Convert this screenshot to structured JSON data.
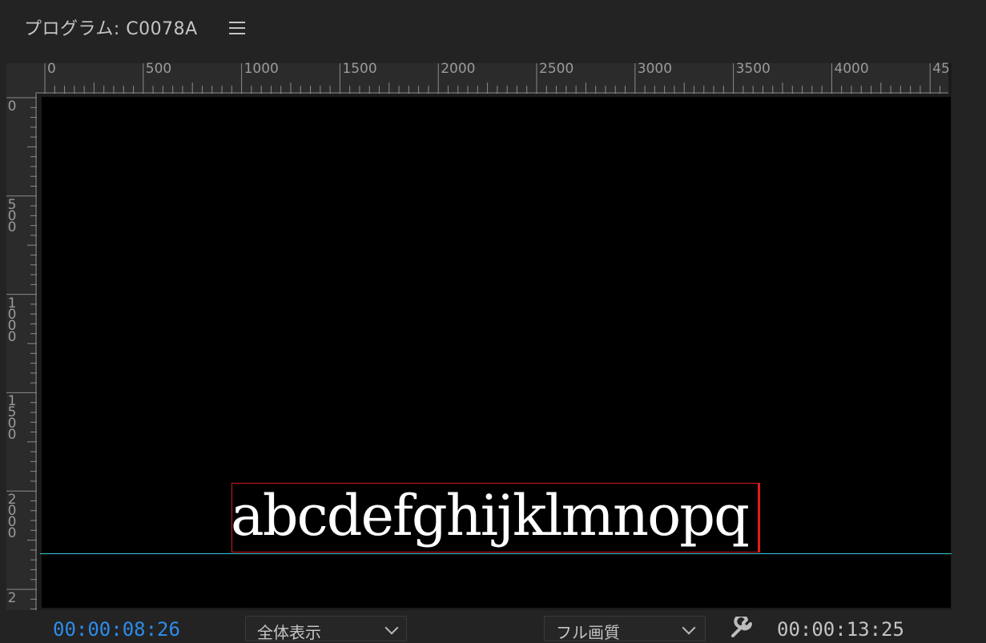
{
  "panel": {
    "title": "プログラム: C0078A",
    "menu_icon": "hamburger-menu-icon"
  },
  "ruler_top": {
    "labels": [
      "0",
      "500",
      "1000",
      "1500",
      "2000",
      "2500",
      "3000",
      "3500",
      "4000",
      "45"
    ]
  },
  "ruler_left": {
    "labels": [
      "0",
      "500",
      "1000",
      "1500",
      "2000",
      "2"
    ]
  },
  "canvas": {
    "text": "abcdefghijklmnopq",
    "text_color": "#ffffff",
    "selection_color": "#e21a1a",
    "guide_color": "#36c8d6",
    "background": "#000000"
  },
  "bottom": {
    "playhead_timecode": "00:00:08:26",
    "playhead_color": "#2d8ceb",
    "fit_dropdown": "全体表示",
    "quality_dropdown": "フル画質",
    "settings_icon": "wrench-icon",
    "duration_timecode": "00:00:13:25"
  }
}
